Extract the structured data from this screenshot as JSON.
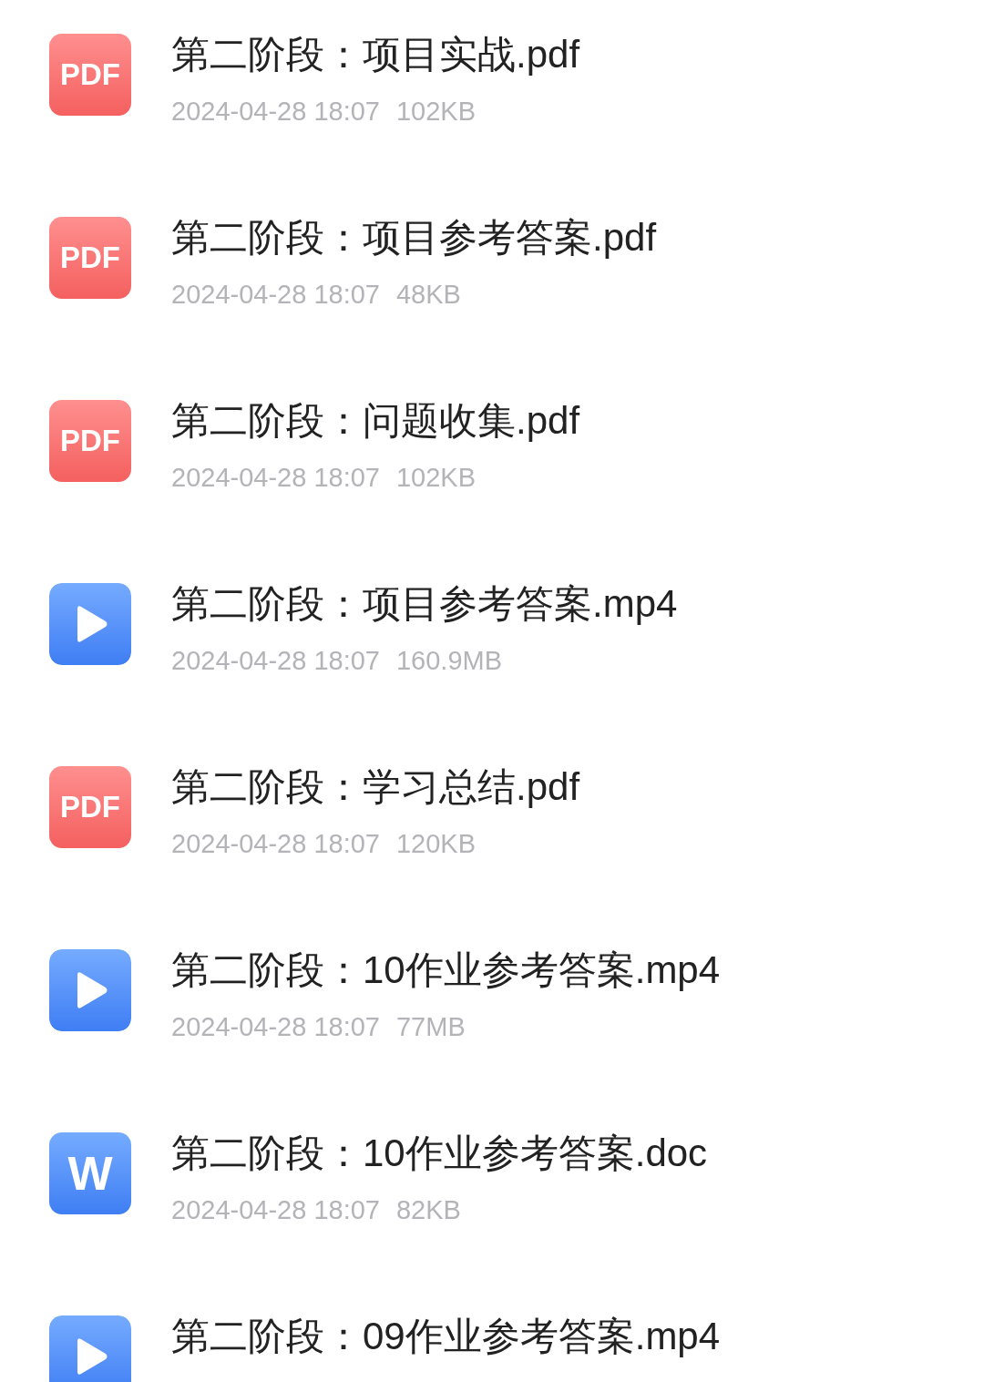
{
  "files": [
    {
      "kind": "pdf",
      "icon_label": "PDF",
      "name": "第二阶段：项目实战.pdf",
      "date": "2024-04-28 18:07",
      "size": "102KB"
    },
    {
      "kind": "pdf",
      "icon_label": "PDF",
      "name": "第二阶段：项目参考答案.pdf",
      "date": "2024-04-28 18:07",
      "size": "48KB"
    },
    {
      "kind": "pdf",
      "icon_label": "PDF",
      "name": "第二阶段：问题收集.pdf",
      "date": "2024-04-28 18:07",
      "size": "102KB"
    },
    {
      "kind": "video",
      "name": "第二阶段：项目参考答案.mp4",
      "date": "2024-04-28 18:07",
      "size": "160.9MB"
    },
    {
      "kind": "pdf",
      "icon_label": "PDF",
      "name": "第二阶段：学习总结.pdf",
      "date": "2024-04-28 18:07",
      "size": "120KB"
    },
    {
      "kind": "video",
      "name": "第二阶段：10作业参考答案.mp4",
      "date": "2024-04-28 18:07",
      "size": "77MB"
    },
    {
      "kind": "word",
      "icon_label": "W",
      "name": "第二阶段：10作业参考答案.doc",
      "date": "2024-04-28 18:07",
      "size": "82KB"
    },
    {
      "kind": "video",
      "name": "第二阶段：09作业参考答案.mp4"
    }
  ]
}
